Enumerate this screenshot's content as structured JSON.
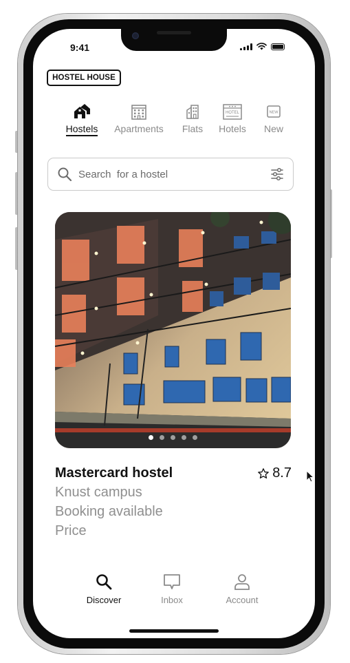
{
  "status_bar": {
    "time": "9:41",
    "icons": [
      "signal-icon",
      "wifi-icon",
      "battery-icon"
    ]
  },
  "app": {
    "logo_text": "HOSTEL HOUSE"
  },
  "categories": [
    {
      "label": "Hostels",
      "icon": "hostel-icon",
      "active": true
    },
    {
      "label": "Apartments",
      "icon": "apartment-icon",
      "active": false
    },
    {
      "label": "Flats",
      "icon": "flat-icon",
      "active": false
    },
    {
      "label": "Hotels",
      "icon": "hotel-icon",
      "active": false
    },
    {
      "label": "New",
      "icon": "new-icon",
      "active": false
    }
  ],
  "hotel_sign_text": "HOTEL",
  "new_badge_text": "NEW",
  "search": {
    "placeholder": "Search  for a hostel",
    "value": ""
  },
  "listing": {
    "name": "Mastercard hostel",
    "rating": "8.7",
    "location": "Knust campus",
    "availability": "Booking available",
    "price_label": "Price",
    "photo_count": 5,
    "active_photo": 1
  },
  "bottom_nav": [
    {
      "label": "Discover",
      "icon": "search-icon",
      "active": true
    },
    {
      "label": "Inbox",
      "icon": "message-icon",
      "active": false
    },
    {
      "label": "Account",
      "icon": "user-icon",
      "active": false
    }
  ],
  "colors": {
    "text_primary": "#111111",
    "text_secondary": "#8f8f8f",
    "border": "#c9c9c9",
    "accent_orange": "#e8805a"
  }
}
